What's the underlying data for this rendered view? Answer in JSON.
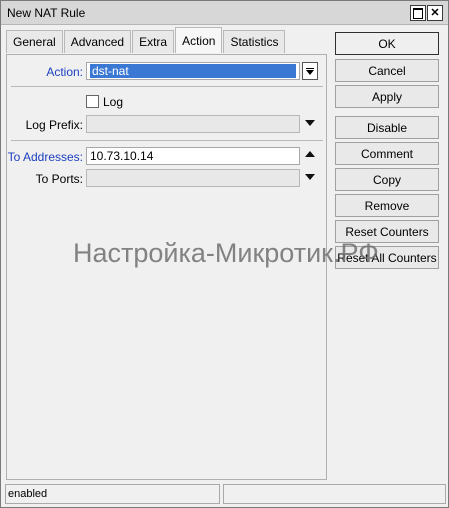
{
  "window": {
    "title": "New NAT Rule"
  },
  "tabs": [
    {
      "label": "General"
    },
    {
      "label": "Advanced"
    },
    {
      "label": "Extra"
    },
    {
      "label": "Action"
    },
    {
      "label": "Statistics"
    }
  ],
  "active_tab": "Action",
  "form": {
    "action_label": "Action:",
    "action_value": "dst-nat",
    "log_label": "Log",
    "log_checked": false,
    "log_prefix_label": "Log Prefix:",
    "log_prefix_value": "",
    "to_addresses_label": "To Addresses:",
    "to_addresses_value": "10.73.10.14",
    "to_ports_label": "To Ports:",
    "to_ports_value": ""
  },
  "buttons": {
    "ok": "OK",
    "cancel": "Cancel",
    "apply": "Apply",
    "disable": "Disable",
    "comment": "Comment",
    "copy": "Copy",
    "remove": "Remove",
    "reset_counters": "Reset Counters",
    "reset_all_counters": "Reset All Counters"
  },
  "watermark": "Настройка-Микротик.РФ",
  "status": {
    "left": "enabled",
    "right": ""
  },
  "colors": {
    "link_label": "#1c3fc0",
    "selection": "#3a78d3",
    "window_bg": "#f0f0f0"
  },
  "icons": {
    "maximize": "maximize-icon",
    "close": "close-icon"
  }
}
